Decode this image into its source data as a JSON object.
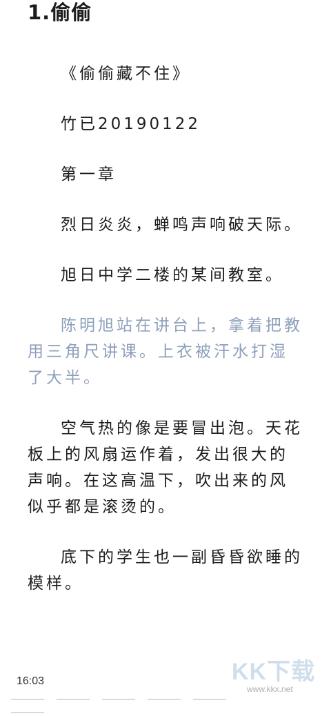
{
  "chapter": {
    "title": "1.偷偷"
  },
  "paragraphs": [
    {
      "text": "《偷偷藏不住》",
      "highlight": false
    },
    {
      "text": "竹已20190122",
      "highlight": false
    },
    {
      "text": "第一章",
      "highlight": false
    },
    {
      "text": "烈日炎炎，蝉鸣声响破天际。",
      "highlight": false
    },
    {
      "text": "旭日中学二楼的某间教室。",
      "highlight": false
    },
    {
      "text": "陈明旭站在讲台上，拿着把教用三角尺讲课。上衣被汗水打湿了大半。",
      "highlight": true
    },
    {
      "text": "空气热的像是要冒出泡。天花板上的风扇运作着，发出很大的声响。在这高温下，吹出来的风似乎都是滚烫的。",
      "highlight": false
    },
    {
      "text": "底下的学生也一副昏昏欲睡的模样。",
      "highlight": false
    }
  ],
  "status": {
    "time": "16:03"
  },
  "watermark": {
    "logo": "KK下载",
    "url": "www.kkx.net"
  },
  "colors": {
    "text": "#1c1c1c",
    "highlight_text": "#8c9fba",
    "background": "#ffffff"
  }
}
